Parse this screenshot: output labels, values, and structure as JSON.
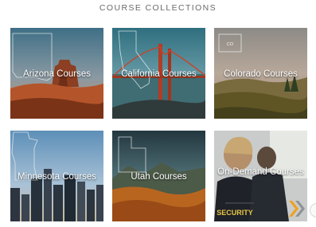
{
  "section": {
    "title": "COURSE COLLECTIONS"
  },
  "tiles": [
    {
      "label": "Arizona Courses"
    },
    {
      "label": "California Courses"
    },
    {
      "label": "Colorado Courses"
    },
    {
      "label": "Minnesota Courses"
    },
    {
      "label": "Utah Courses"
    },
    {
      "label": "On-Demand Courses"
    }
  ],
  "badges": {
    "colorado_map_abbr": "CO",
    "security_vest_text": "SECURITY"
  },
  "colors": {
    "label_text": "#ffffff",
    "title_text": "#6b6b6b",
    "accent_chevron": "#f0a020"
  }
}
